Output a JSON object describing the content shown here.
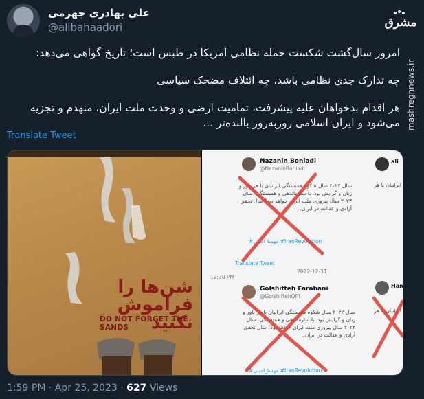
{
  "author": {
    "name": "علی بهادری جهرمی",
    "handle": "@alibahaadori"
  },
  "source": {
    "logo_text": "مشرق",
    "watermark": "mashreghnews.ir"
  },
  "tweet": {
    "paragraphs": [
      "امروز سال‌گشت شکست حمله نظامی آمریکا در طبس است؛ تاریخ گواهی می‌دهد:",
      "چه تدارک جدی نظامی باشد، چه ائتلاف مضحک سیاسی",
      "هر اقدام بدخواهان علیه پیشرفت، تمامیت ارضی و وحدت ملت ایران، منهدم و تجزیه می‌شود و ایران اسلامی روزبه‌روز بالنده‌تر ..."
    ],
    "translate_label": "Translate Tweet"
  },
  "media": {
    "poster": {
      "title_fa": "شن‌ها را فراموش نکنید",
      "title_en": "DO NOT FORGET THE SANDS"
    },
    "screenshot": {
      "tweets": [
        {
          "name": "Nazanin Boniadi",
          "handle": "@NazaninBoniadi",
          "body": "سال ۲۰۲۲ سال شکوه همبستگی ایرانیان با هر باور و زبان و گرایش بود. با سازماندهی و همبستگی، سال ۲۰۲۳ سال پیروزی ملت ایران خواهد بود! سال تحقق آزادی و عدالت در ایران.",
          "tags": "#مهسا_امینی #IranRevolution",
          "time": "Translate Tweet",
          "date": "2022-12-31"
        },
        {
          "name": "Golshifteh Farahani",
          "handle": "@GolshiftehOffi",
          "body": "سال ۲۰۲۲ سال شکوه همبستگی ایرانیان با هر باور و زبان و گرایش بود. با سازماندهی و همبستگی، سال ۲۰۲۳ سال پیروزی ملت ایران خواهد بود! سال تحقق آزادی و عدالت در ایران.",
          "tags": "#مهسا_امینی #IranRevolution",
          "time": "12:30 PM"
        },
        {
          "name": "Hamed",
          "handle": ""
        },
        {
          "name": "ali",
          "handle": ""
        }
      ]
    }
  },
  "meta": {
    "time": "1:59 PM",
    "separator": "·",
    "date": "Apr 25, 2023",
    "views_count": "627",
    "views_label": "Views"
  }
}
